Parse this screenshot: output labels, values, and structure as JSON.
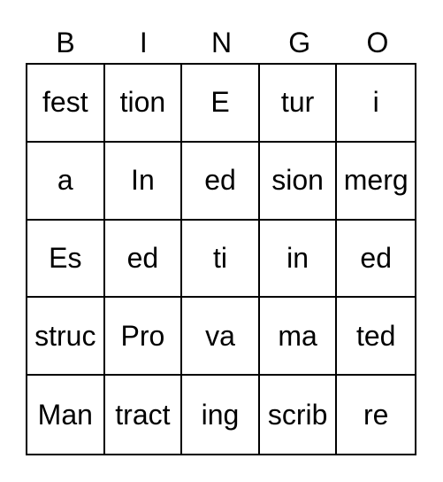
{
  "header": [
    "B",
    "I",
    "N",
    "G",
    "O"
  ],
  "cells": [
    [
      "fest",
      "tion",
      "E",
      "tur",
      "i"
    ],
    [
      "a",
      "In",
      "ed",
      "sion",
      "merg"
    ],
    [
      "Es",
      "ed",
      "ti",
      "in",
      "ed"
    ],
    [
      "struc",
      "Pro",
      "va",
      "ma",
      "ted"
    ],
    [
      "Man",
      "tract",
      "ing",
      "scrib",
      "re"
    ]
  ]
}
